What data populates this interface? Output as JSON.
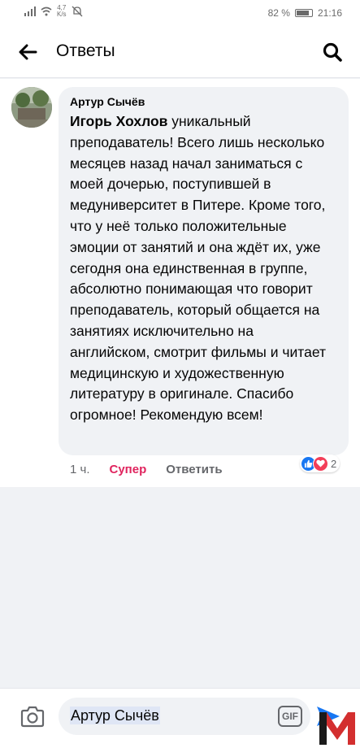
{
  "status_bar": {
    "speed_value": "4,7",
    "speed_unit": "K/s",
    "battery_percent": "82 %",
    "battery_level": 0.82,
    "time": "21:16"
  },
  "header": {
    "title": "Ответы",
    "back_icon": "arrow-left-icon",
    "search_icon": "search-icon"
  },
  "comment": {
    "author": "Артур Сычёв",
    "mention": "Игорь Хохлов",
    "text": " уникальный преподаватель! Всего лишь несколько месяцев назад начал заниматься с моей дочерью, поступившей в медуниверситет в Питере. Кроме того, что у неё только положительные эмоции от занятий и она ждёт их, уже сегодня она единственная в группе, абсолютно понимающая что говорит преподаватель, который общается на занятиях исключительно на английском, смотрит фильмы и читает медицинскую и художественную литературу в оригинале. Спасибо огромное! Рекомендую всем!",
    "time": "1 ч.",
    "reaction_label": "Супер",
    "reply_label": "Ответить",
    "reaction_count": "2"
  },
  "input": {
    "value": "Артур Сычёв",
    "gif_label": "GIF"
  },
  "colors": {
    "accent": "#1877f2",
    "super": "#e0245e",
    "love": "#f33e58",
    "watermark": "#d32f2f"
  }
}
